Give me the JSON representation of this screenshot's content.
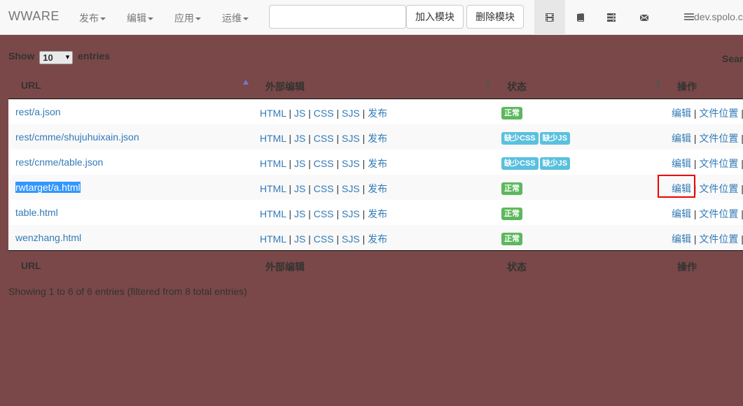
{
  "navbar": {
    "brand": "WWARE",
    "menus": [
      {
        "label": "发布"
      },
      {
        "label": "编辑"
      },
      {
        "label": "应用"
      },
      {
        "label": "运维"
      }
    ],
    "module_input_value": "",
    "add_module_label": "加入模块",
    "remove_module_label": "删除模块",
    "icons": [
      "film-icon",
      "book-icon",
      "server-icon",
      "envelope-icon"
    ],
    "server_text": "dev.spolo.c"
  },
  "table": {
    "length": {
      "prefix": "Show",
      "value": "10",
      "suffix": "entries"
    },
    "search_label": "Search:",
    "columns": [
      "URL",
      "外部编辑",
      "状态",
      "操作"
    ],
    "rows": [
      {
        "url": "rest/a.json",
        "links": [
          "HTML",
          "JS",
          "CSS",
          "SJS",
          "发布"
        ],
        "status": [
          {
            "text": "正常",
            "kind": "success"
          }
        ],
        "actions": [
          "编辑",
          "文件位置"
        ]
      },
      {
        "url": "rest/cmme/shujuhuixain.json",
        "links": [
          "HTML",
          "JS",
          "CSS",
          "SJS",
          "发布"
        ],
        "status": [
          {
            "text": "缺少CSS",
            "kind": "info"
          },
          {
            "text": "缺少JS",
            "kind": "info"
          }
        ],
        "actions": [
          "编辑",
          "文件位置"
        ]
      },
      {
        "url": "rest/cnme/table.json",
        "links": [
          "HTML",
          "JS",
          "CSS",
          "SJS",
          "发布"
        ],
        "status": [
          {
            "text": "缺少CSS",
            "kind": "info"
          },
          {
            "text": "缺少JS",
            "kind": "info"
          }
        ],
        "actions": [
          "编辑",
          "文件位置"
        ]
      },
      {
        "url": "rwtarget/a.html",
        "links": [
          "HTML",
          "JS",
          "CSS",
          "SJS",
          "发布"
        ],
        "status": [
          {
            "text": "正常",
            "kind": "success"
          }
        ],
        "actions": [
          "编辑",
          "文件位置"
        ]
      },
      {
        "url": "table.html",
        "links": [
          "HTML",
          "JS",
          "CSS",
          "SJS",
          "发布"
        ],
        "status": [
          {
            "text": "正常",
            "kind": "success"
          }
        ],
        "actions": [
          "编辑",
          "文件位置"
        ]
      },
      {
        "url": "wenzhang.html",
        "links": [
          "HTML",
          "JS",
          "CSS",
          "SJS",
          "发布"
        ],
        "status": [
          {
            "text": "正常",
            "kind": "success"
          }
        ],
        "actions": [
          "编辑",
          "文件位置"
        ]
      }
    ],
    "info": "Showing 1 to 6 of 6 entries (filtered from 8 total entries)"
  },
  "colors": {
    "background": "#7a4848",
    "link": "#337ab7",
    "success": "#5cb85c",
    "info": "#5bc0de",
    "highlight": "#ee0000"
  }
}
